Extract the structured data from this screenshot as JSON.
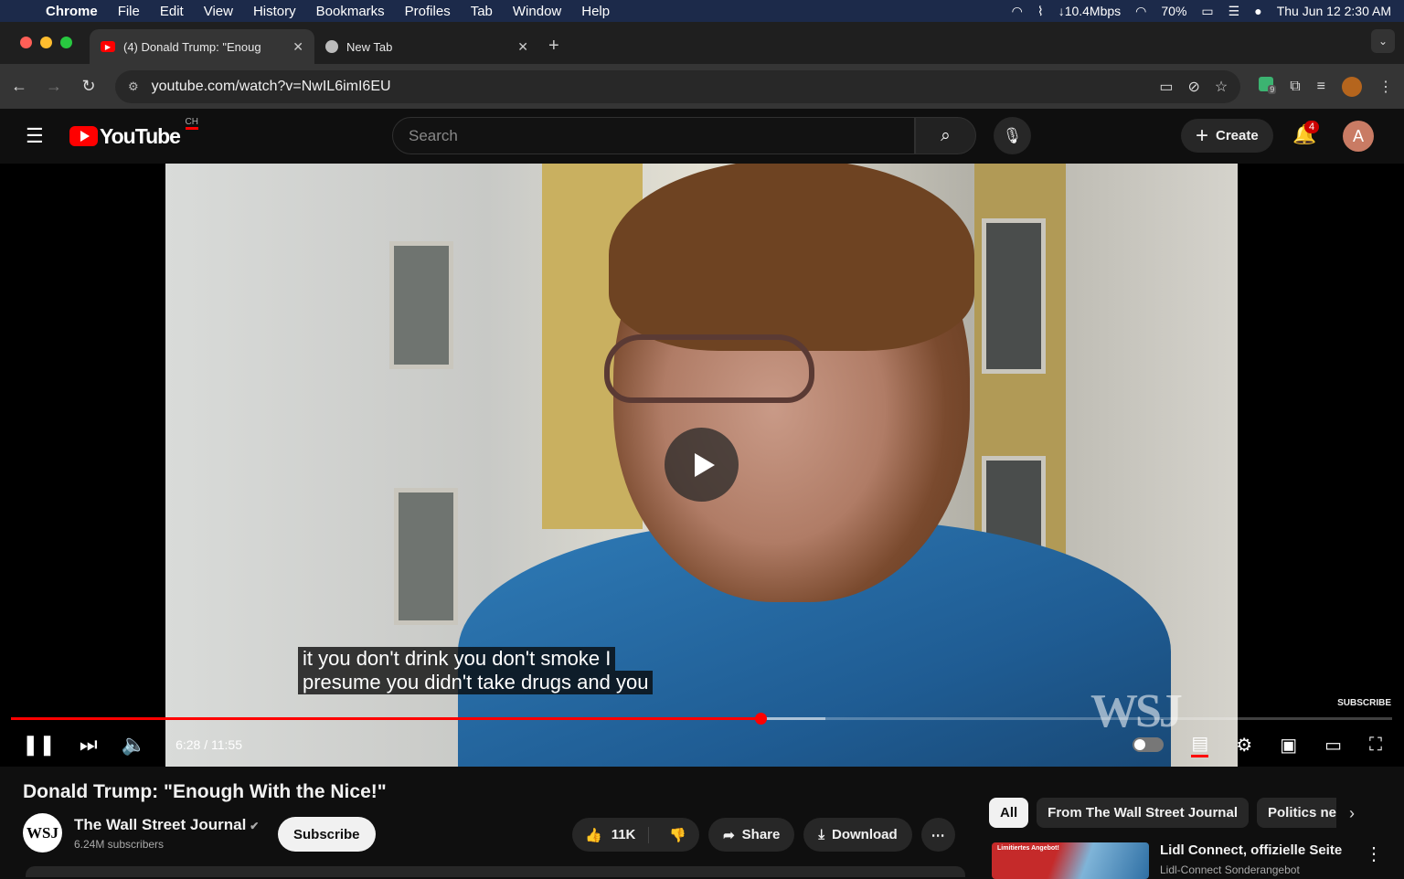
{
  "menubar": {
    "app": "Chrome",
    "items": [
      "File",
      "Edit",
      "View",
      "History",
      "Bookmarks",
      "Profiles",
      "Tab",
      "Window",
      "Help"
    ],
    "network": "↓10.4Mbps",
    "battery": "70%",
    "datetime": "Thu Jun 12  2:30 AM"
  },
  "tabs": [
    {
      "title": "(4) Donald Trump: \"Enoug",
      "active": true
    },
    {
      "title": "New Tab",
      "active": false
    }
  ],
  "omnibox": {
    "url": "youtube.com/watch?v=NwIL6imI6EU"
  },
  "extensions": {
    "badge": "9"
  },
  "youtube": {
    "logo_text": "YouTube",
    "country": "CH",
    "search_placeholder": "Search",
    "create_label": "Create",
    "notif_count": "4",
    "avatar_letter": "A"
  },
  "player": {
    "caption_line1": "it you don't drink you don't smoke I",
    "caption_line2": "presume you didn't take drugs and you",
    "watermark": "WSJ",
    "subscribe_wm": "SUBSCRIBE",
    "time": "6:28 / 11:55",
    "progress_fraction": 0.543,
    "buffered_fraction": 0.59
  },
  "video": {
    "title": "Donald Trump: \"Enough With the Nice!\"",
    "channel": "The Wall Street Journal",
    "channel_logo": "WSJ",
    "subscribers": "6.24M subscribers",
    "subscribe_label": "Subscribe",
    "likes": "11K",
    "share_label": "Share",
    "download_label": "Download"
  },
  "sidebar": {
    "chips": [
      "All",
      "From The Wall Street Journal",
      "Politics new"
    ],
    "ad_title": "Lidl Connect, offizielle Seite",
    "ad_sub": "Lidl-Connect Sonderangebot",
    "ad_thumb_text": "Limitiertes Angebot!"
  },
  "colors": {
    "accent": "#ff0000",
    "background": "#0f0f0f"
  }
}
